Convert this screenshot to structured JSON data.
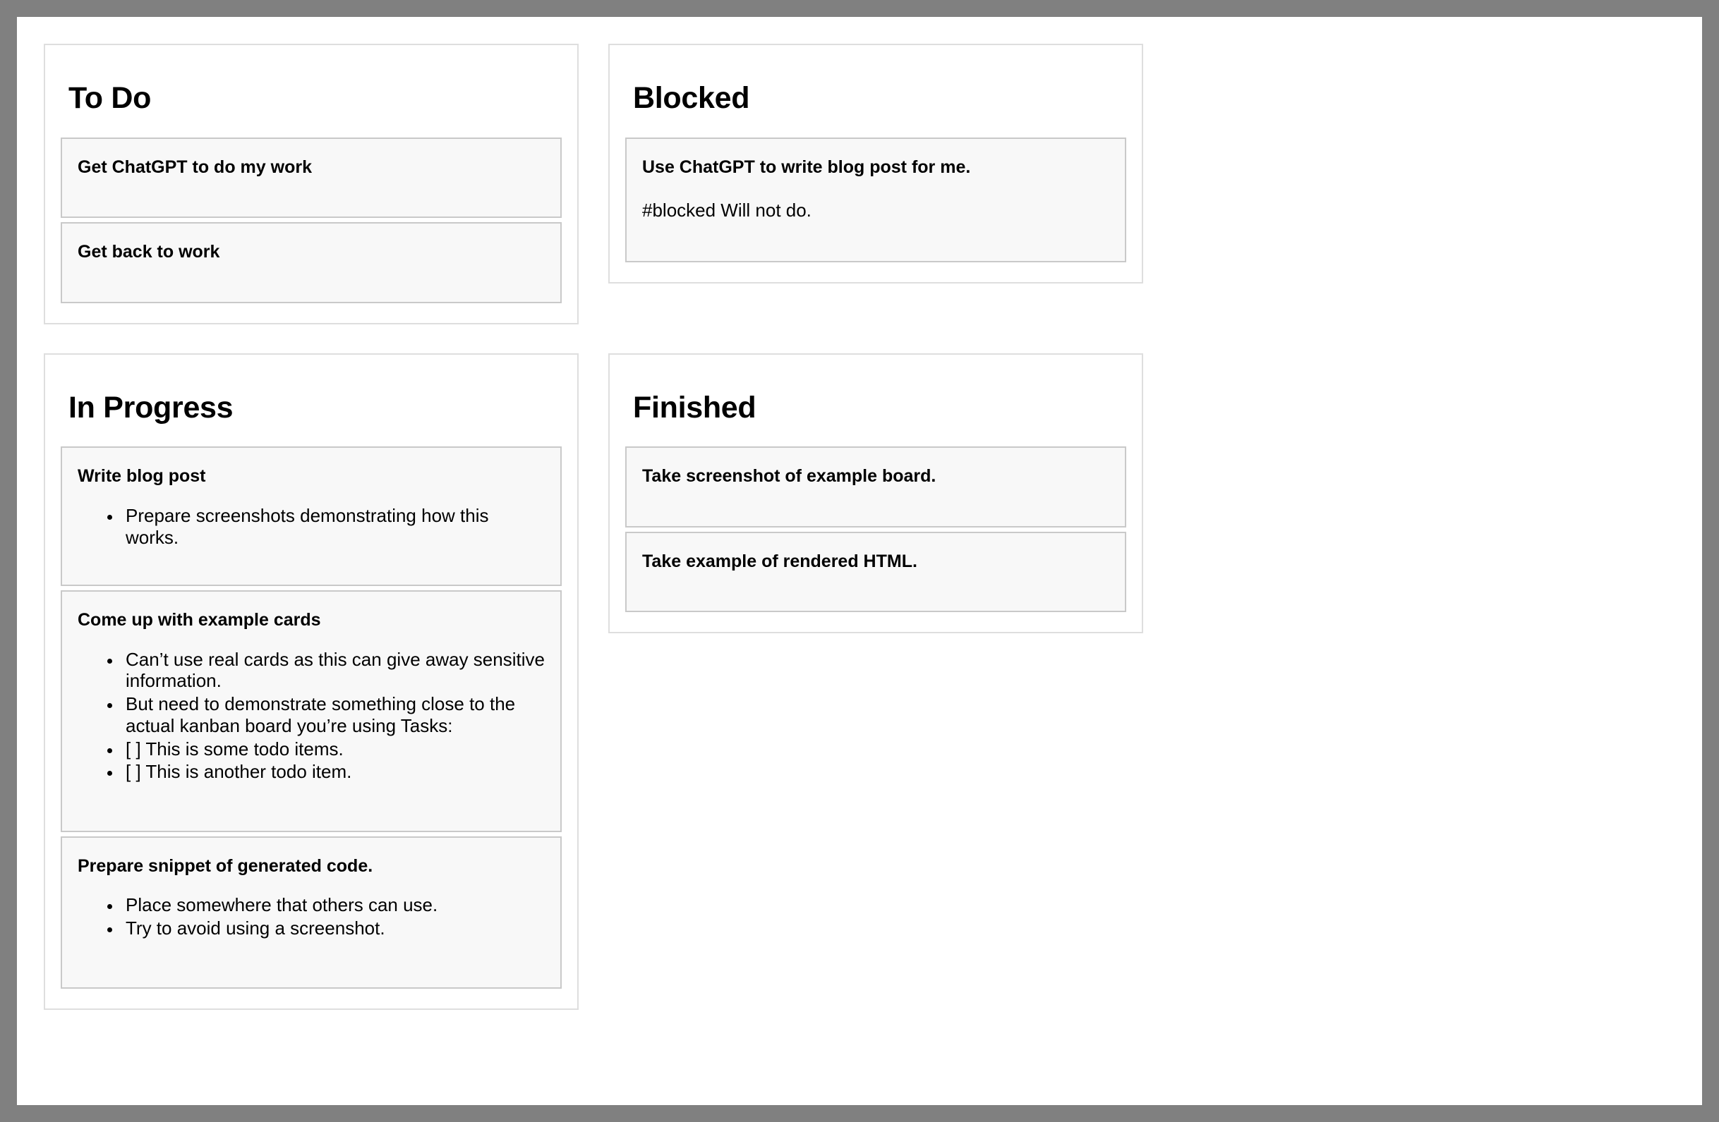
{
  "board": {
    "background_color": "#808080",
    "page_color": "#ffffff",
    "panel_border_color": "#dedede",
    "card_background_color": "#f8f8f8",
    "card_border_color": "#c9c9c9",
    "columns": [
      {
        "title": "To Do",
        "cards": [
          {
            "title": "Get ChatGPT to do my work",
            "body": [],
            "bullets": []
          },
          {
            "title": "Get back to work",
            "body": [],
            "bullets": []
          }
        ]
      },
      {
        "title": "Blocked",
        "cards": [
          {
            "title": "Use ChatGPT to write blog post for me.",
            "body": [
              "#blocked Will not do."
            ],
            "bullets": []
          }
        ]
      },
      {
        "title": "In Progress",
        "cards": [
          {
            "title": "Write blog post",
            "body": [],
            "bullets": [
              "Prepare screenshots demonstrating how this works."
            ]
          },
          {
            "title": "Come up with example cards",
            "body": [],
            "bullets": [
              "Can’t use real cards as this can give away sensitive information.",
              "But need to demonstrate something close to the actual kanban board you’re using Tasks:",
              "[ ] This is some todo items.",
              "[ ] This is another todo item."
            ]
          },
          {
            "title": "Prepare snippet of generated code.",
            "body": [],
            "bullets": [
              "Place somewhere that others can use.",
              "Try to avoid using a screenshot."
            ]
          }
        ]
      },
      {
        "title": "Finished",
        "cards": [
          {
            "title": "Take screenshot of example board.",
            "body": [],
            "bullets": []
          },
          {
            "title": "Take example of rendered HTML.",
            "body": [],
            "bullets": []
          }
        ]
      }
    ]
  }
}
